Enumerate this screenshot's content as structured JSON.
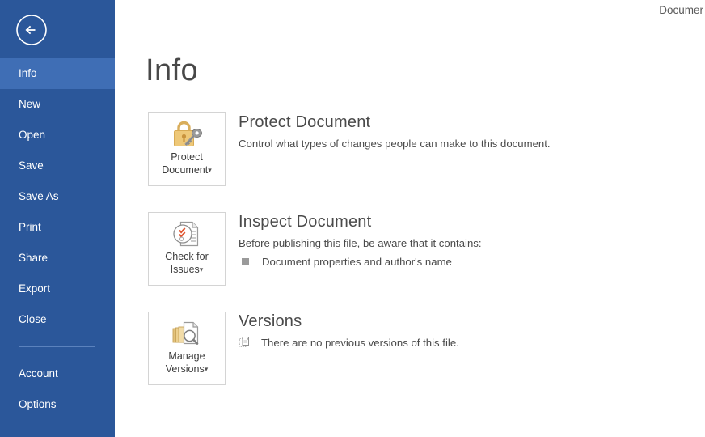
{
  "window": {
    "document_title": "Documer"
  },
  "sidebar": {
    "back_icon": "back-arrow-circle-icon",
    "items": [
      {
        "label": "Info",
        "selected": true,
        "group": "upper"
      },
      {
        "label": "New",
        "selected": false,
        "group": "upper"
      },
      {
        "label": "Open",
        "selected": false,
        "group": "upper"
      },
      {
        "label": "Save",
        "selected": false,
        "group": "upper"
      },
      {
        "label": "Save As",
        "selected": false,
        "group": "upper"
      },
      {
        "label": "Print",
        "selected": false,
        "group": "upper"
      },
      {
        "label": "Share",
        "selected": false,
        "group": "upper"
      },
      {
        "label": "Export",
        "selected": false,
        "group": "upper"
      },
      {
        "label": "Close",
        "selected": false,
        "group": "upper"
      },
      {
        "label": "Account",
        "selected": false,
        "group": "lower"
      },
      {
        "label": "Options",
        "selected": false,
        "group": "lower"
      }
    ]
  },
  "page": {
    "title": "Info"
  },
  "sections": [
    {
      "id": "protect-document",
      "button": {
        "line1": "Protect",
        "line2": "Document",
        "caret": "▾",
        "icon": "padlock-key-icon"
      },
      "heading": "Protect Document",
      "subtext": "Control what types of changes people can make to this document.",
      "bullets": []
    },
    {
      "id": "inspect-document",
      "button": {
        "line1": "Check for",
        "line2": "Issues",
        "caret": "▾",
        "icon": "document-inspect-check-icon"
      },
      "heading": "Inspect Document",
      "subtext": "Before publishing this file, be aware that it contains:",
      "bullets": [
        "Document properties and author's name"
      ]
    },
    {
      "id": "versions",
      "button": {
        "line1": "Manage",
        "line2": "Versions",
        "caret": "▾",
        "icon": "document-stack-magnifier-icon"
      },
      "heading": "Versions",
      "subtext": "There are no previous versions of this file.",
      "bullets": [],
      "subtext_icon": "document-stack-small-icon"
    }
  ],
  "colors": {
    "sidebar_bg": "#2b579a",
    "sidebar_selected": "#3f6eb5",
    "sidebar_text": "#ffffff",
    "heading_text": "#4a4a4a",
    "button_border": "#d4d4d4",
    "lock_gold": "#e8c170",
    "key_gray": "#8f8f8f",
    "check_orange": "#e8603c",
    "bullet_gray": "#9a9a9a"
  }
}
